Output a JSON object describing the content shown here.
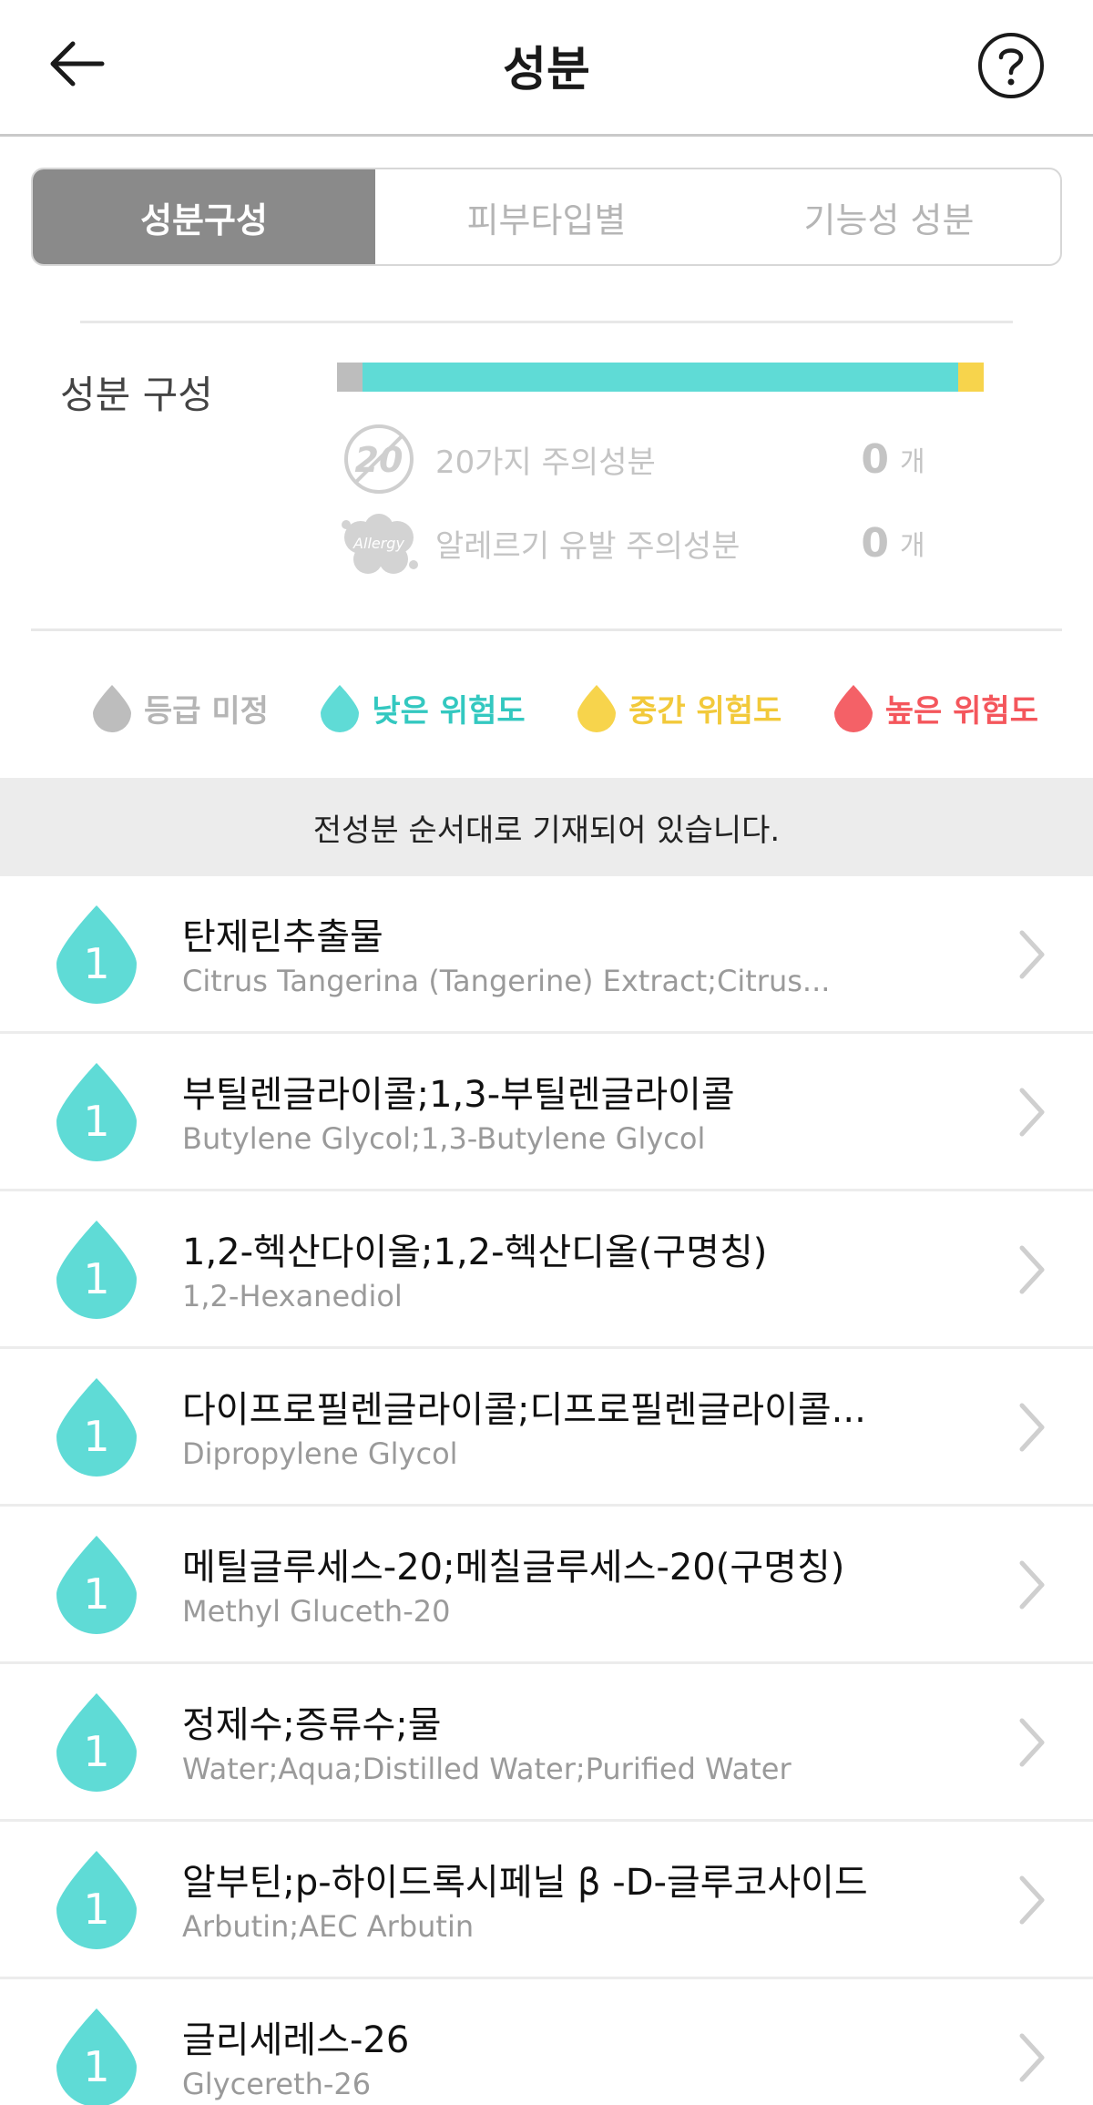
{
  "header": {
    "title": "성분"
  },
  "tabs": [
    {
      "label": "성분구성",
      "active": true
    },
    {
      "label": "피부타입별",
      "active": false
    },
    {
      "label": "기능성 성분",
      "active": false
    }
  ],
  "composition": {
    "label": "성분 구성",
    "bar": [
      {
        "level": "unrated",
        "fraction": 0.04,
        "color": "#bdbdbd"
      },
      {
        "level": "low",
        "fraction": 0.92,
        "color": "#5fdbd6"
      },
      {
        "level": "medium",
        "fraction": 0.04,
        "color": "#f7d44c"
      }
    ],
    "warnings": [
      {
        "icon": "twenty-icon",
        "icon_text": "20",
        "text": "20가지 주의성분",
        "count": "0",
        "unit": "개"
      },
      {
        "icon": "allergy-icon",
        "icon_text": "Allergy",
        "text": "알레르기 유발 주의성분",
        "count": "0",
        "unit": "개"
      }
    ]
  },
  "legend": [
    {
      "label": "등급 미정",
      "color": "#bdbdbd",
      "text_color": "#b5b5b5"
    },
    {
      "label": "낮은 위험도",
      "color": "#5fdbd6",
      "text_color": "#33c8c0"
    },
    {
      "label": "중간 위험도",
      "color": "#f7d44c",
      "text_color": "#f2c93a"
    },
    {
      "label": "높은 위험도",
      "color": "#f46167",
      "text_color": "#f4565c"
    }
  ],
  "notice": "전성분 순서대로 기재되어 있습니다.",
  "ingredients": [
    {
      "grade": "1",
      "name": "탄제린추출물",
      "en": "Citrus Tangerina (Tangerine) Extract;Citrus..."
    },
    {
      "grade": "1",
      "name": "부틸렌글라이콜;1,3-부틸렌글라이콜",
      "en": "Butylene Glycol;1,3-Butylene Glycol"
    },
    {
      "grade": "1",
      "name": "1,2-헥산다이올;1,2-헥산디올(구명칭)",
      "en": "1,2-Hexanediol"
    },
    {
      "grade": "1",
      "name": "다이프로필렌글라이콜;디프로필렌글라이콜...",
      "en": "Dipropylene Glycol"
    },
    {
      "grade": "1",
      "name": "메틸글루세스-20;메칠글루세스-20(구명칭)",
      "en": "Methyl Gluceth-20"
    },
    {
      "grade": "1",
      "name": "정제수;증류수;물",
      "en": "Water;Aqua;Distilled Water;Purified Water"
    },
    {
      "grade": "1",
      "name": "알부틴;p-하이드록시페닐 β -D-글루코사이드",
      "en": "Arbutin;AEC Arbutin"
    },
    {
      "grade": "1",
      "name": "글리세레스-26",
      "en": "Glycereth-26"
    }
  ],
  "colors": {
    "low": "#5fdbd6",
    "tab_active_bg": "#8a8a8a"
  }
}
